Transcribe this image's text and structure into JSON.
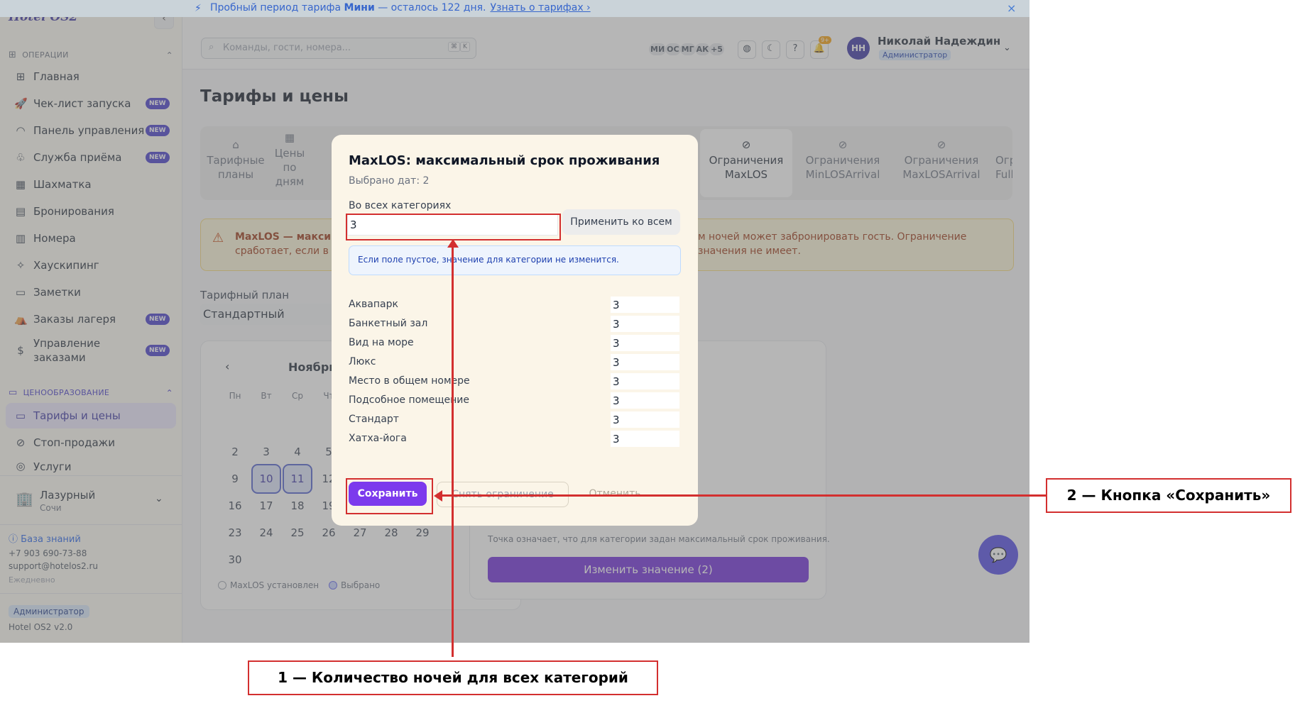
{
  "banner": {
    "text_prefix": "Пробный период тарифа ",
    "plan": "Мини",
    "text_suffix": " — осталось 122 дня.",
    "link": "Узнать о тарифах ›",
    "close": "×"
  },
  "sidebar": {
    "logo": "Hotel OS2",
    "collapse": "‹",
    "section_ops": "ОПЕРАЦИИ",
    "items": [
      {
        "label": "Главная",
        "icon": "⊞",
        "badge": ""
      },
      {
        "label": "Чек-лист запуска",
        "icon": "🚀",
        "badge": "NEW"
      },
      {
        "label": "Панель управления",
        "icon": "◠",
        "badge": "NEW"
      },
      {
        "label": "Служба приёма",
        "icon": "♧",
        "badge": "NEW"
      },
      {
        "label": "Шахматка",
        "icon": "▦",
        "badge": ""
      },
      {
        "label": "Бронирования",
        "icon": "▤",
        "badge": ""
      },
      {
        "label": "Номера",
        "icon": "▥",
        "badge": ""
      },
      {
        "label": "Хаускипинг",
        "icon": "✧",
        "badge": ""
      },
      {
        "label": "Заметки",
        "icon": "▭",
        "badge": ""
      },
      {
        "label": "Заказы лагеря",
        "icon": "⛺",
        "badge": "NEW"
      },
      {
        "label": "Управление\nзаказами",
        "icon": "$",
        "badge": "NEW"
      }
    ],
    "section_pricing": "ЦЕНООБРАЗОВАНИЕ",
    "pricing_items": [
      {
        "label": "Тарифы и цены",
        "icon": "▭"
      },
      {
        "label": "Стоп-продажи",
        "icon": "⊘"
      },
      {
        "label": "Услуги",
        "icon": "◎"
      }
    ],
    "hotel": {
      "name": "Лазурный",
      "city": "Сочи"
    },
    "knowledge_base": "База знаний",
    "phone": "+7 903 690-73-88",
    "email": "support@hotelos2.ru",
    "schedule": "Ежедневно",
    "role": "Администратор",
    "version": "Hotel OS2 v2.0"
  },
  "topbar": {
    "search_placeholder": "Команды, гости, номера...",
    "kbd1": "⌘",
    "kbd2": "K",
    "avatars": [
      "МИ",
      "ОС",
      "МГ",
      "АК",
      "+5"
    ],
    "notif_count": "9+",
    "user_initials": "НН",
    "user_name": "Николай Надеждин",
    "user_role": "Администратор"
  },
  "main": {
    "title": "Тарифы и цены",
    "tabs": [
      {
        "label": "Тарифные\nпланы"
      },
      {
        "label": "Цены\nпо\nдням"
      },
      {
        "label": "Ограничения\nMaxLOS"
      },
      {
        "label": "Ограничения\nMinLOSArrival"
      },
      {
        "label": "Ограничения\nMaxLOSArrival"
      },
      {
        "label": "Огра\nFullPa"
      }
    ],
    "alert": {
      "bold": "MaxLOS — максим",
      "line2": "сработает, если в п",
      "right1": "м ночей может забронировать гость. Ограничение",
      "right2": "значения не имеет."
    },
    "plan_label": "Тарифный план",
    "plan_value": "Стандартный",
    "calendar": {
      "month": "Ноябрь",
      "weekdays": [
        "Пн",
        "Вт",
        "Ср",
        "Чт"
      ],
      "week1": [
        "2",
        "3",
        "4",
        "5"
      ],
      "week2": [
        "9",
        "10",
        "11",
        "12"
      ],
      "week3": [
        "16",
        "17",
        "18",
        "19"
      ],
      "week4": [
        "23",
        "24",
        "25",
        "26",
        "27",
        "28",
        "29"
      ],
      "week5": [
        "30"
      ],
      "legend_set": "MaxLOS установлен",
      "legend_selected": "Выбрано"
    },
    "side_note": "Точка означает, что для категории задан максимальный срок проживания.",
    "change_button": "Изменить значение (2)"
  },
  "modal": {
    "title": "MaxLOS: максимальный срок проживания",
    "subtitle": "Выбрано дат: 2",
    "all_label": "Во всех категориях",
    "all_value": "3",
    "apply_button": "Применить ко всем",
    "info": "Если поле пустое, значение для категории не изменится.",
    "categories": [
      {
        "name": "Аквапарк",
        "value": "3"
      },
      {
        "name": "Банкетный зал",
        "value": "3"
      },
      {
        "name": "Вид на море",
        "value": "3"
      },
      {
        "name": "Люкс",
        "value": "3"
      },
      {
        "name": "Место в общем номере",
        "value": "3"
      },
      {
        "name": "Подсобное помещение",
        "value": "3"
      },
      {
        "name": "Стандарт",
        "value": "3"
      },
      {
        "name": "Хатха-йога",
        "value": "3"
      }
    ],
    "save_button": "Сохранить",
    "remove_button": "Снять ограничение",
    "cancel_button": "Отменить"
  },
  "annotations": {
    "label1": "1 — Количество ночей для всех категорий",
    "label2": "2 — Кнопка «Сохранить»",
    "color": "#d32f2f"
  }
}
